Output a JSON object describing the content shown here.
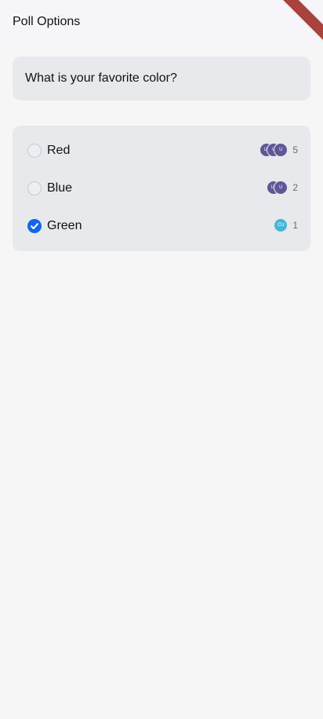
{
  "header": {
    "title": "Poll Options"
  },
  "poll": {
    "question": "What is your favorite color?",
    "options": [
      {
        "label": "Red",
        "selected": false,
        "votes": "5",
        "voter_initials": [
          "U2",
          "U",
          "U"
        ],
        "avatar_color": "#5f5796"
      },
      {
        "label": "Blue",
        "selected": false,
        "votes": "2",
        "voter_initials": [
          "U1",
          "U"
        ],
        "avatar_color": "#5f5796"
      },
      {
        "label": "Green",
        "selected": true,
        "votes": "1",
        "voter_initials": [
          "CU"
        ],
        "avatar_color": "#45b6d3"
      }
    ]
  },
  "colors": {
    "accent": "#1565e8",
    "card_bg": "#e8e9ed",
    "ribbon": "#a8433d"
  }
}
